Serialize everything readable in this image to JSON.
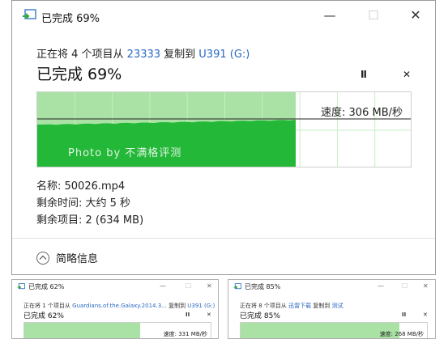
{
  "dialog": {
    "title": "已完成 69%",
    "copy_prefix": "正在将 4 个项目从 ",
    "source": "23333",
    "copy_mid": " 复制到 ",
    "destination": "U391 (G:)",
    "headline": "已完成 69%",
    "speed": "速度: 306 MB/秒",
    "watermark": "Photo by 不满格评测",
    "name_row": "名称: 50026.mp4",
    "time_row": "剩余时间: 大约 5 秒",
    "items_row": "剩余项目: 2 (634 MB)",
    "details_label": "简略信息",
    "min_glyph": "—",
    "max_glyph": "☐",
    "close_glyph": "✕",
    "pause_glyph": "II",
    "cancel_glyph": "✕",
    "progress": 0.69,
    "colors": {
      "accent_green": "#23b838",
      "light_green": "#a9e2a4",
      "link_blue": "#2a69c2"
    }
  },
  "thumbs": [
    {
      "title": "已完成 62%",
      "copy_prefix": "正在将 1 个项目从 ",
      "source": "Guardians.of.the.Galaxy.2014.3...",
      "copy_mid": " 复制到 ",
      "destination": "U391 (G:)",
      "headline": "已完成 62%",
      "speed": "速度: 331 MB/秒",
      "progress": 0.62
    },
    {
      "title": "已完成 85%",
      "copy_prefix": "正在将 8 个项目从 ",
      "source": "迅雷下载",
      "copy_mid": " 复制到 ",
      "destination": "测试",
      "headline": "已完成 85%",
      "speed": "速度: 268 MB/秒",
      "progress": 0.85
    }
  ]
}
